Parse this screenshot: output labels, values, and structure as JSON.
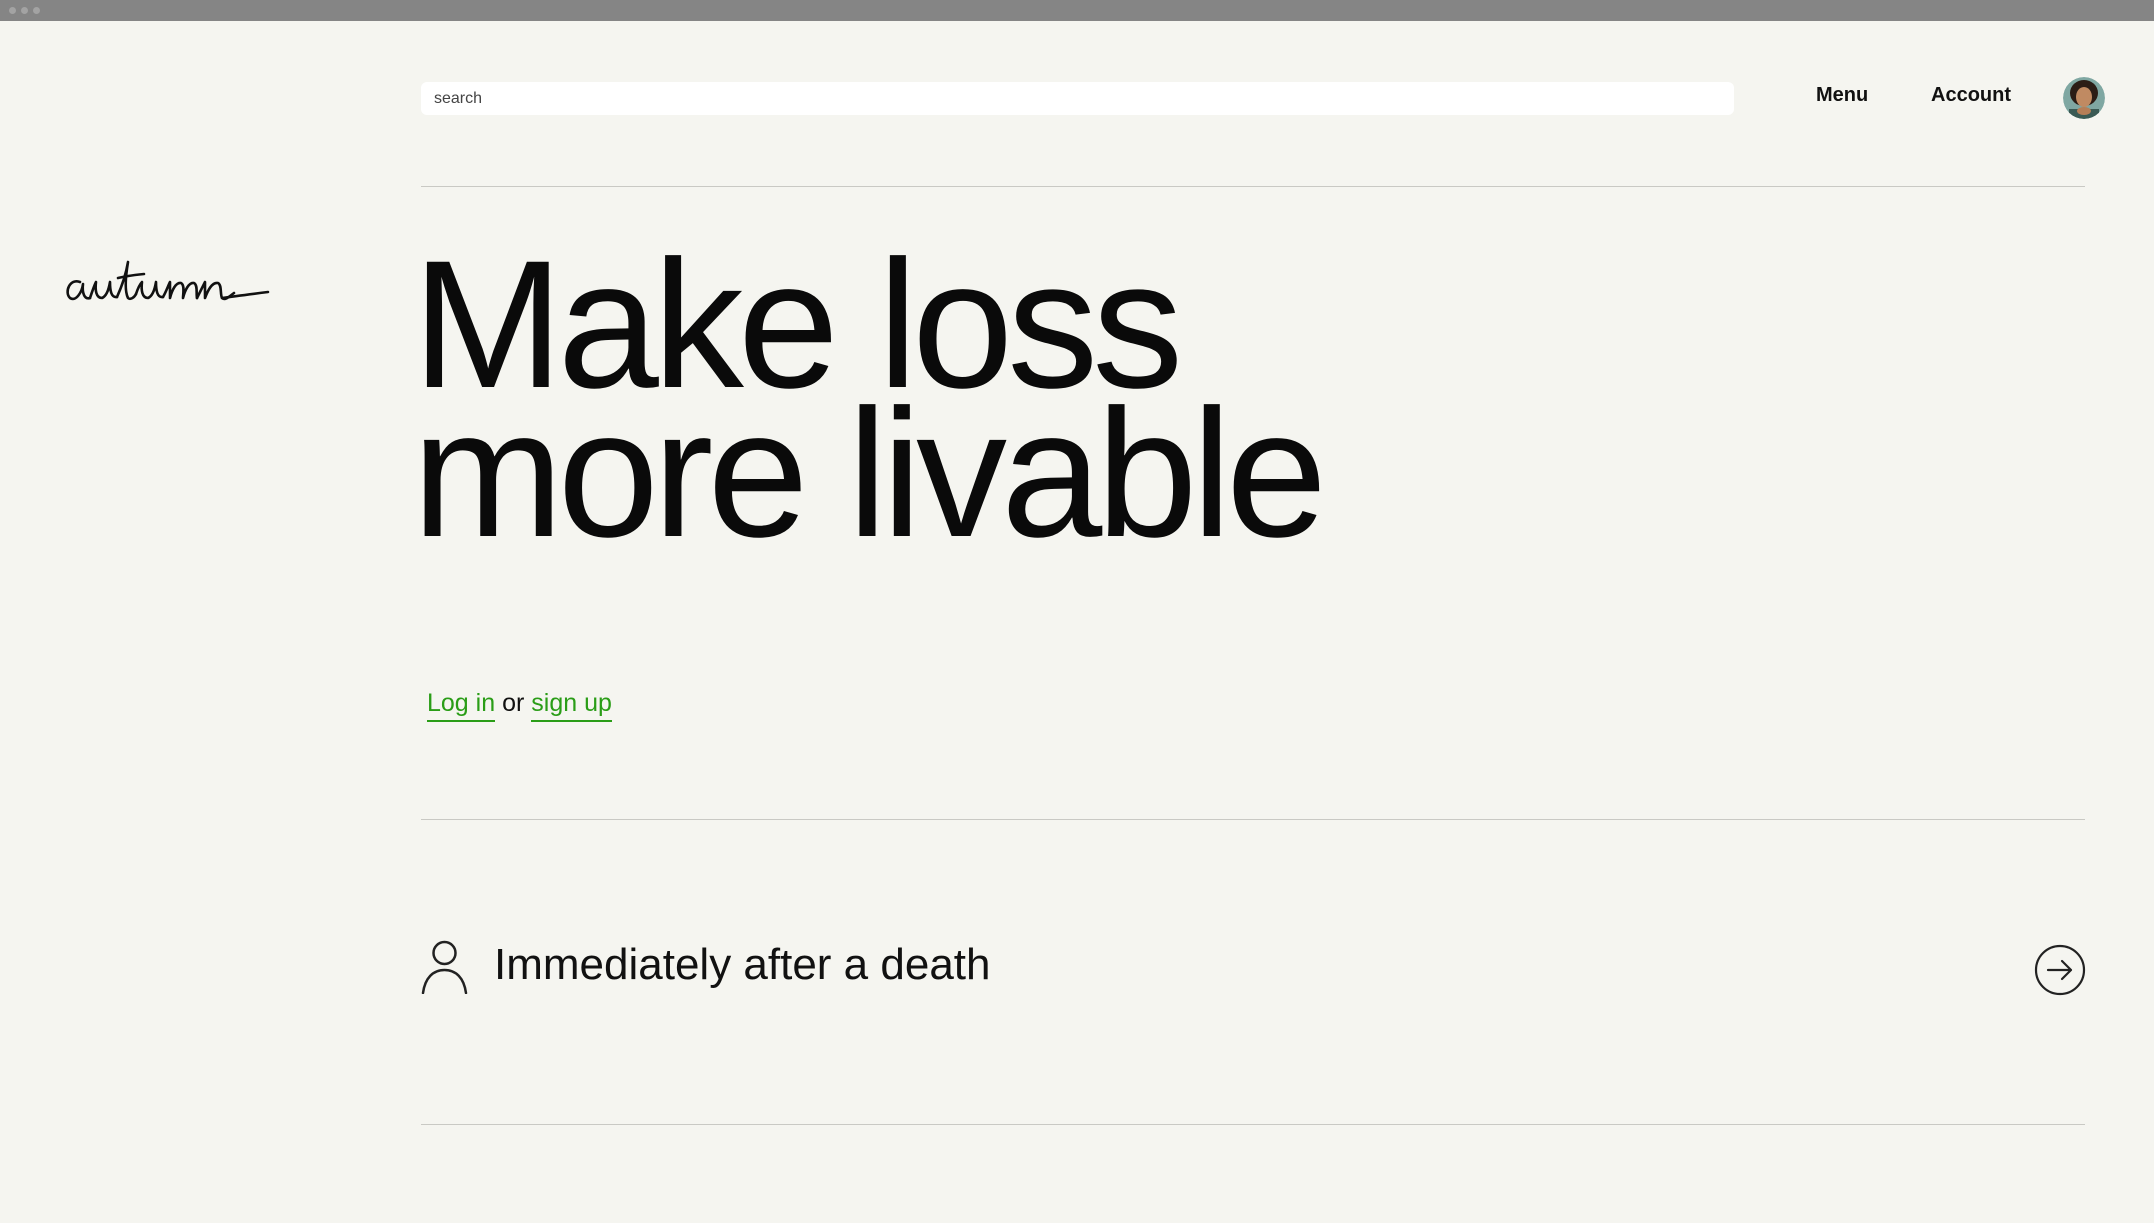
{
  "window": {
    "title_bar_dots": 3
  },
  "brand": {
    "logo_text": "autumn"
  },
  "header": {
    "search_placeholder": "search",
    "menu_label": "Menu",
    "account_label": "Account",
    "avatar_alt": "user avatar"
  },
  "hero": {
    "line1": "Make loss",
    "line2": "more livable"
  },
  "auth": {
    "login_label": "Log in",
    "or_text": "or",
    "signup_label": "sign up"
  },
  "sections": [
    {
      "icon": "person-icon",
      "label": "Immediately after a death",
      "action_icon": "arrow-right-circle-icon"
    }
  ],
  "colors": {
    "background": "#f5f5f0",
    "accent_green": "#2a9d17",
    "text": "#111111",
    "title_bar": "#858585"
  }
}
